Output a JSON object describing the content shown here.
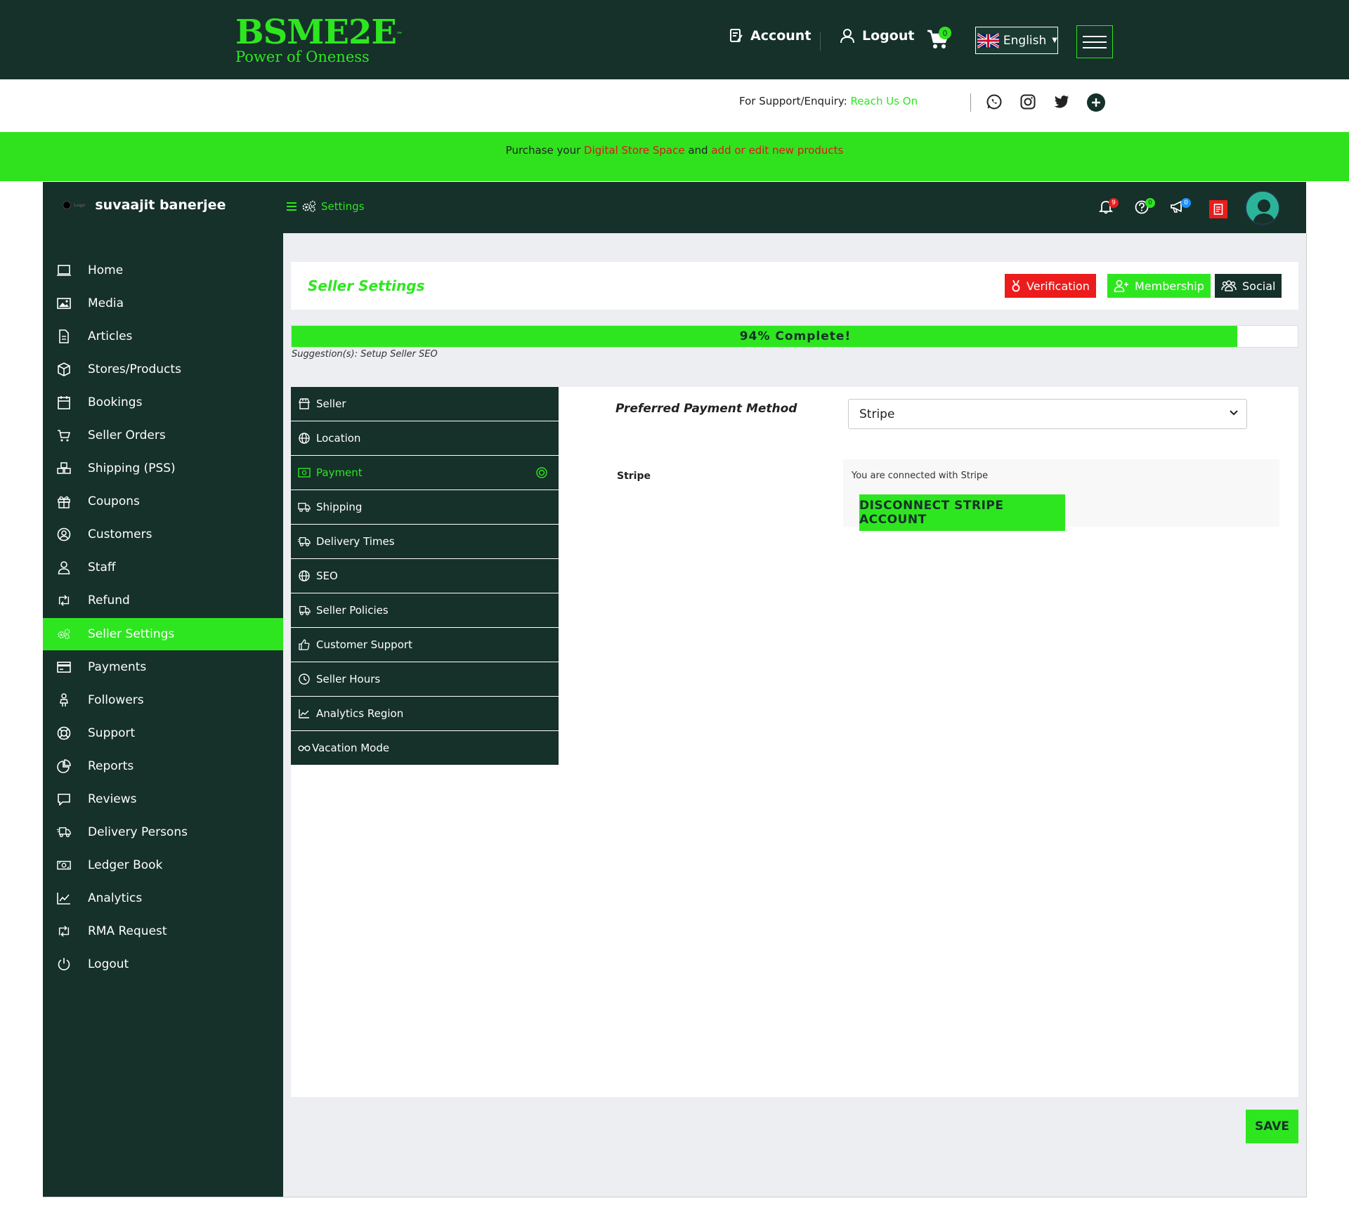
{
  "header": {
    "logo_main": "BSME2E",
    "logo_tm": "™",
    "logo_sub": "Power of Oneness",
    "account_label": "Account",
    "logout_label": "Logout",
    "cart_count": "0",
    "language": "English",
    "icons": [
      "account-icon",
      "user-icon",
      "cart-icon",
      "uk-flag-icon",
      "hamburger-icon"
    ]
  },
  "support": {
    "text": "For Support/Enquiry:",
    "link": "Reach Us On",
    "icons": [
      "whatsapp-icon",
      "instagram-icon",
      "twitter-icon",
      "plus-icon"
    ]
  },
  "promo": {
    "prefix": "Purchase your ",
    "link1": "Digital Store Space",
    "middle": " and ",
    "link2": "add or edit new products"
  },
  "dashboard": {
    "user_name": "suvaajit banerjee",
    "small_logo": "Logo",
    "breadcrumb": "Settings",
    "badges": {
      "notifications": "9",
      "help": "0",
      "announcements": "0"
    }
  },
  "sidebar": {
    "items": [
      {
        "label": "Home",
        "icon": "home-icon"
      },
      {
        "label": "Media",
        "icon": "image-icon"
      },
      {
        "label": "Articles",
        "icon": "document-icon"
      },
      {
        "label": "Stores/Products",
        "icon": "cube-icon"
      },
      {
        "label": "Bookings",
        "icon": "calendar-icon"
      },
      {
        "label": "Seller Orders",
        "icon": "cart-icon"
      },
      {
        "label": "Shipping (PSS)",
        "icon": "boxes-icon"
      },
      {
        "label": "Coupons",
        "icon": "gift-icon"
      },
      {
        "label": "Customers",
        "icon": "user-circle-icon"
      },
      {
        "label": "Staff",
        "icon": "user-icon"
      },
      {
        "label": "Refund",
        "icon": "retweet-icon"
      },
      {
        "label": "Seller Settings",
        "icon": "cogs-icon"
      },
      {
        "label": "Payments",
        "icon": "credit-card-icon"
      },
      {
        "label": "Followers",
        "icon": "female-icon"
      },
      {
        "label": "Support",
        "icon": "lifebuoy-icon"
      },
      {
        "label": "Reports",
        "icon": "pie-chart-icon"
      },
      {
        "label": "Reviews",
        "icon": "comment-icon"
      },
      {
        "label": "Delivery Persons",
        "icon": "shipping-fast-icon"
      },
      {
        "label": "Ledger Book",
        "icon": "money-icon"
      },
      {
        "label": "Analytics",
        "icon": "chart-line-icon"
      },
      {
        "label": "RMA Request",
        "icon": "retweet-icon"
      },
      {
        "label": "Logout",
        "icon": "power-icon"
      }
    ],
    "active_index": 11
  },
  "settings": {
    "title": "Seller Settings",
    "buttons": {
      "verification": "Verification",
      "membership": "Membership",
      "social": "Social"
    },
    "progress_text": "94% Complete!",
    "progress_value": 0.94,
    "suggestion": "Suggestion(s): Setup Seller SEO",
    "tabs": [
      {
        "label": "Seller",
        "icon": "store-icon"
      },
      {
        "label": "Location",
        "icon": "globe-icon"
      },
      {
        "label": "Payment",
        "icon": "money-bill-icon"
      },
      {
        "label": "Shipping",
        "icon": "truck-icon"
      },
      {
        "label": "Delivery Times",
        "icon": "shipping-fast-icon"
      },
      {
        "label": "SEO",
        "icon": "globe-icon"
      },
      {
        "label": "Seller Policies",
        "icon": "shipping-fast-icon"
      },
      {
        "label": "Customer Support",
        "icon": "thumbs-up-icon"
      },
      {
        "label": "Seller Hours",
        "icon": "clock-icon"
      },
      {
        "label": "Analytics Region",
        "icon": "chart-line-icon"
      },
      {
        "label": "Vacation Mode",
        "icon": "glasses-icon"
      }
    ],
    "active_tab": 2,
    "payment": {
      "preferred_label": "Preferred Payment Method",
      "selected_method": "Stripe",
      "stripe_label": "Stripe",
      "stripe_status": "You are connected with Stripe",
      "disconnect_label": "DISCONNECT STRIPE ACCOUNT"
    },
    "save_label": "SAVE"
  },
  "colors": {
    "dark_green": "#16302a",
    "brand_green": "#2ee620",
    "red": "#ec1c1c"
  }
}
